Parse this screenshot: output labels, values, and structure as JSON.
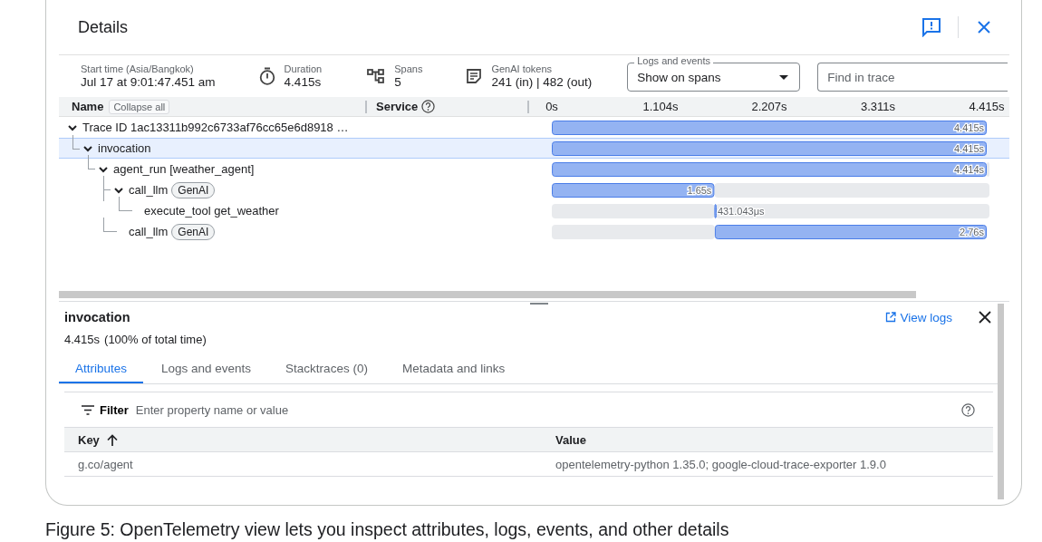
{
  "header": {
    "title": "Details"
  },
  "summary": [
    {
      "kind": "time",
      "label": "Start time (Asia/Bangkok)",
      "value": "Jul 17 at 9:01:47.451 am"
    },
    {
      "kind": "duration",
      "label": "Duration",
      "value": "4.415s"
    },
    {
      "kind": "spans",
      "label": "Spans",
      "value": "5"
    },
    {
      "kind": "tokens",
      "label": "GenAI tokens",
      "value": "241 (in) | 482 (out)"
    }
  ],
  "logs_dropdown": {
    "label": "Logs and events",
    "value": "Show on spans"
  },
  "find_field": {
    "placeholder": "Find in trace"
  },
  "columns": {
    "name": "Name",
    "collapse_button": "Collapse all",
    "service": "Service"
  },
  "spans": [
    {
      "name": "Trace ID 1ac13311b992c6733af76cc65e6d8918 …",
      "expanded": true,
      "selected": false,
      "children": [
        {
          "name": "invocation",
          "expanded": true,
          "selected": true,
          "children": [
            {
              "name": "agent_run [weather_agent]",
              "expanded": true,
              "selected": false,
              "children": [
                {
                  "name": "call_llm",
                  "badge": "GenAI",
                  "expanded": true,
                  "selected": false,
                  "children": [
                    {
                      "name": "execute_tool get_weather",
                      "selected": false
                    }
                  ]
                },
                {
                  "name": "call_llm",
                  "badge": "GenAI",
                  "selected": false
                }
              ]
            }
          ]
        }
      ]
    }
  ],
  "timeline": {
    "chart_data": {
      "type": "bar",
      "orientation": "horizontal",
      "stacked": true,
      "xlim": [
        0,
        4.415
      ],
      "categories": [
        null,
        null,
        null,
        null,
        null,
        null
      ],
      "xticks": [
        {
          "value": 0,
          "label": "0s"
        },
        {
          "value": 1.104,
          "label": "1.104s"
        },
        {
          "value": 2.207,
          "label": "2.207s"
        },
        {
          "value": 3.311,
          "label": "3.311s"
        },
        {
          "value": 4.415,
          "label": "4.415s"
        }
      ],
      "series": [
        {
          "color": "#e8eaed",
          "values": [
            0,
            0,
            0.001,
            0,
            1.65,
            1.655
          ]
        },
        {
          "color": "#94b3f2",
          "values": [
            4.415,
            4.415,
            4.414,
            1.65,
            0.000431,
            2.76
          ]
        }
      ],
      "value_labels": [
        "4.415s",
        "4.415s",
        "4.414s",
        "1.65s",
        "431.043μs",
        "2.76s"
      ]
    }
  },
  "details": {
    "title": "invocation",
    "duration": "4.415s",
    "share": "(100% of total time)",
    "view_logs": "View logs",
    "tabs": [
      {
        "label": "Attributes",
        "selected": true
      },
      {
        "label": "Logs and events",
        "selected": false
      },
      {
        "label": "Stacktraces (0)",
        "selected": false
      },
      {
        "label": "Metadata and links",
        "selected": false
      }
    ],
    "filter": {
      "label": "Filter",
      "placeholder": "Enter property name or value"
    },
    "table": {
      "columns": [
        {
          "label": "Key",
          "sorted": true
        },
        {
          "label": "Value",
          "sorted": false
        }
      ],
      "rows": [
        [
          "g.co/agent",
          "opentelemetry-python 1.35.0; google-cloud-trace-exporter 1.9.0"
        ]
      ]
    }
  },
  "caption": "Figure 5: OpenTelemetry view lets you inspect attributes, logs, events, and other details"
}
